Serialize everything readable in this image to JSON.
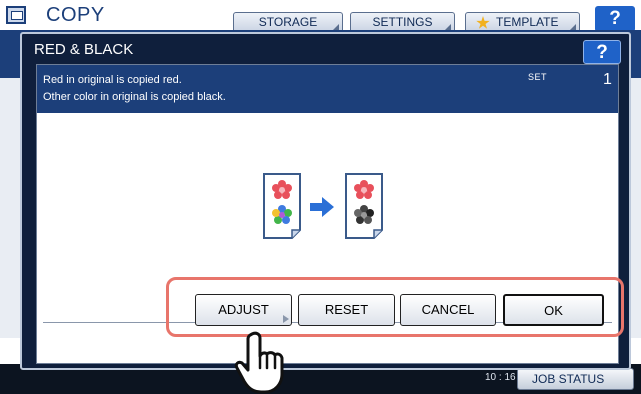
{
  "background": {
    "app_title": "COPY",
    "tabs": [
      {
        "label": "STORAGE"
      },
      {
        "label": "SETTINGS"
      },
      {
        "label": "TEMPLATE"
      }
    ],
    "help_label": "?",
    "footer": {
      "time": "10 : 16",
      "job_status_label": "JOB STATUS"
    }
  },
  "dialog": {
    "title": "RED & BLACK",
    "help_label": "?",
    "info": {
      "line1": "Red in original is copied red.",
      "line2": "Other color in original is copied black.",
      "set_label": "SET",
      "set_value": "1"
    },
    "buttons": {
      "adjust": "ADJUST",
      "reset": "RESET",
      "cancel": "CANCEL",
      "ok": "OK"
    }
  },
  "colors": {
    "accent_blue": "#1c3f7a",
    "help_blue": "#1f62c8",
    "highlight_outline": "#e8756b",
    "arrow_blue": "#2a6fd6"
  },
  "icons": {
    "original_document": "color-flower-document-icon",
    "arrow": "arrow-right-icon",
    "result_document": "red-black-flower-document-icon",
    "cursor": "hand-pointer-cursor"
  }
}
